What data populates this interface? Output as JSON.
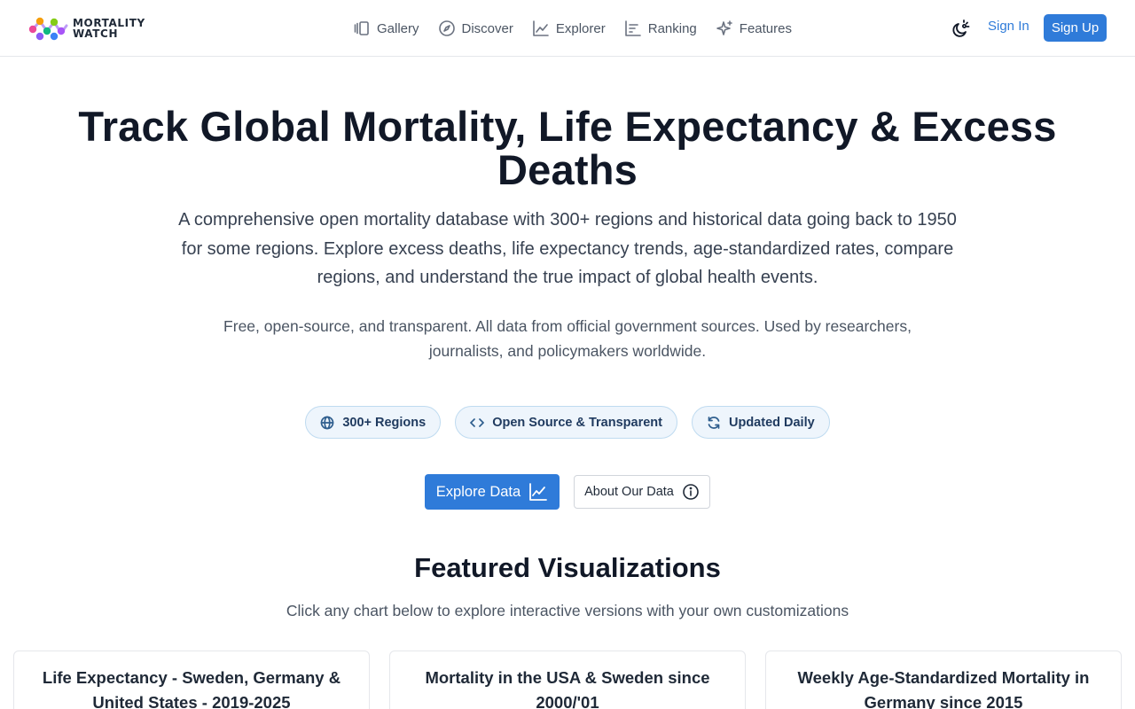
{
  "header": {
    "logo_line1": "MORTALITY",
    "logo_line2": "WATCH",
    "nav": [
      {
        "label": "Gallery",
        "icon": "gallery-icon"
      },
      {
        "label": "Discover",
        "icon": "compass-icon"
      },
      {
        "label": "Explorer",
        "icon": "line-chart-icon"
      },
      {
        "label": "Ranking",
        "icon": "ranking-icon"
      },
      {
        "label": "Features",
        "icon": "sparkles-icon"
      }
    ],
    "theme_icon": "theme-toggle-icon",
    "sign_in": "Sign In",
    "sign_up": "Sign Up"
  },
  "hero": {
    "title": "Track Global Mortality, Life Expectancy & Excess Deaths",
    "subtitle": "A comprehensive open mortality database with 300+ regions and historical data going back to 1950 for some regions. Explore excess deaths, life expectancy trends, age-standardized rates, compare regions, and understand the true impact of global health events.",
    "note": "Free, open-source, and transparent. All data from official government sources. Used by researchers, journalists, and policymakers worldwide.",
    "pills": [
      {
        "label": "300+ Regions",
        "icon": "globe-icon"
      },
      {
        "label": "Open Source & Transparent",
        "icon": "code-icon"
      },
      {
        "label": "Updated Daily",
        "icon": "refresh-icon"
      }
    ],
    "explore_button": "Explore Data",
    "about_button": "About Our Data"
  },
  "featured": {
    "title": "Featured Visualizations",
    "subtitle": "Click any chart below to explore interactive versions with your own customizations",
    "cards": [
      {
        "title": "Life Expectancy - Sweden, Germany & United States - 2019-2025"
      },
      {
        "title": "Mortality in the USA & Sweden since 2000/'01"
      },
      {
        "title": "Weekly Age-Standardized Mortality in Germany since 2015"
      }
    ]
  },
  "colors": {
    "accent": "#2f7bd9",
    "pill_bg": "#eef5fc",
    "pill_border": "#bfdbf0",
    "text_dark": "#111827"
  }
}
